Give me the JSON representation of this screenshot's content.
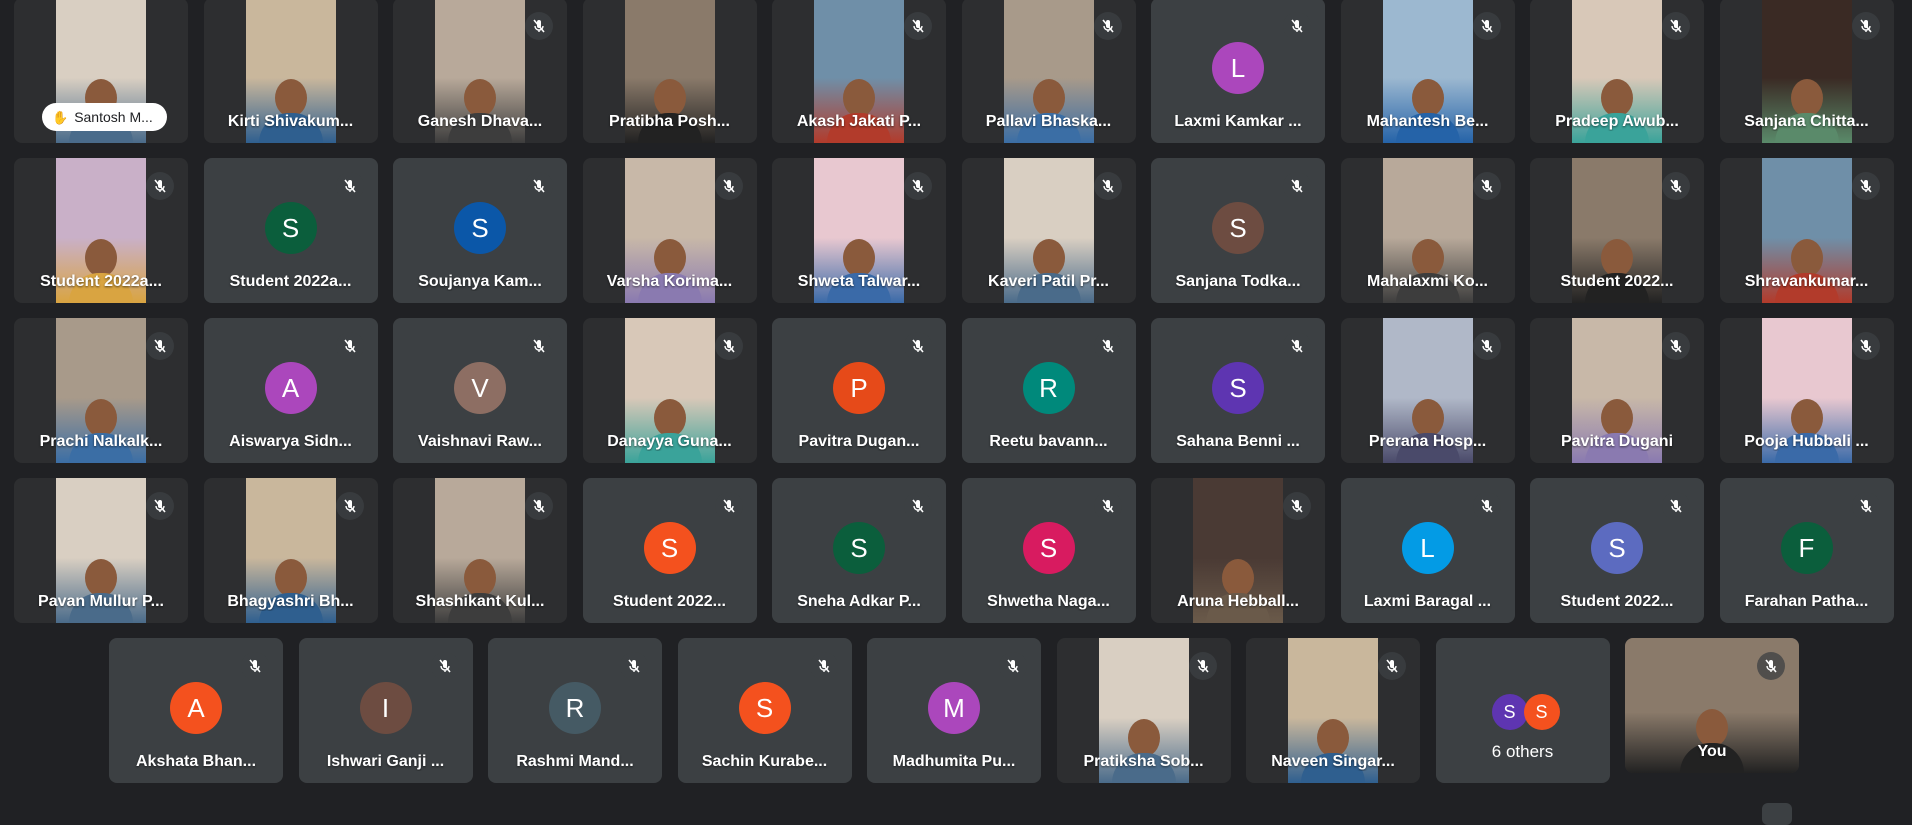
{
  "participants": [
    {
      "name": "Santosh M...",
      "type": "video",
      "muted": false,
      "raised_hand": true
    },
    {
      "name": "Kirti Shivakum...",
      "type": "video",
      "muted": false
    },
    {
      "name": "Ganesh Dhava...",
      "type": "video",
      "muted": true
    },
    {
      "name": "Pratibha Posh...",
      "type": "video",
      "muted": false
    },
    {
      "name": "Akash Jakati P...",
      "type": "video",
      "muted": true
    },
    {
      "name": "Pallavi Bhaska...",
      "type": "video",
      "muted": true
    },
    {
      "name": "Laxmi Kamkar ...",
      "type": "avatar",
      "initial": "L",
      "color": "#ab47bc",
      "muted": true
    },
    {
      "name": "Mahantesh Be...",
      "type": "video",
      "muted": true
    },
    {
      "name": "Pradeep Awub...",
      "type": "video",
      "muted": true
    },
    {
      "name": "Sanjana Chitta...",
      "type": "video",
      "muted": true
    },
    {
      "name": "Student 2022a...",
      "type": "video",
      "muted": true
    },
    {
      "name": "Student 2022a...",
      "type": "avatar",
      "initial": "S",
      "color": "#0b5e3c",
      "muted": true
    },
    {
      "name": "Soujanya Kam...",
      "type": "avatar",
      "initial": "S",
      "color": "#0b57a8",
      "muted": true
    },
    {
      "name": "Varsha Korima...",
      "type": "video",
      "muted": true
    },
    {
      "name": "Shweta Talwar...",
      "type": "video",
      "muted": true
    },
    {
      "name": "Kaveri Patil Pr...",
      "type": "video",
      "muted": true
    },
    {
      "name": "Sanjana Todka...",
      "type": "avatar",
      "initial": "S",
      "color": "#6d4c41",
      "muted": true
    },
    {
      "name": "Mahalaxmi Ko...",
      "type": "video",
      "muted": true
    },
    {
      "name": "Student 2022...",
      "type": "video",
      "muted": true
    },
    {
      "name": "Shravankumar...",
      "type": "video",
      "muted": true
    },
    {
      "name": "Prachi Nalkalk...",
      "type": "video",
      "muted": true
    },
    {
      "name": "Aiswarya Sidn...",
      "type": "avatar",
      "initial": "A",
      "color": "#ab47bc",
      "muted": true
    },
    {
      "name": "Vaishnavi Raw...",
      "type": "avatar",
      "initial": "V",
      "color": "#8d6e63",
      "muted": true
    },
    {
      "name": "Danayya Guna...",
      "type": "video",
      "muted": true
    },
    {
      "name": "Pavitra Dugan...",
      "type": "avatar",
      "initial": "P",
      "color": "#e64a19",
      "muted": true
    },
    {
      "name": "Reetu bavann...",
      "type": "avatar",
      "initial": "R",
      "color": "#00897b",
      "muted": true
    },
    {
      "name": "Sahana Benni ...",
      "type": "avatar",
      "initial": "S",
      "color": "#5e35b1",
      "muted": true
    },
    {
      "name": "Prerana Hosp...",
      "type": "video",
      "muted": true
    },
    {
      "name": "Pavitra Dugani",
      "type": "video",
      "muted": true
    },
    {
      "name": "Pooja Hubbali ...",
      "type": "video",
      "muted": true
    },
    {
      "name": "Pavan Mullur P...",
      "type": "video",
      "muted": true
    },
    {
      "name": "Bhagyashri Bh...",
      "type": "video",
      "muted": true
    },
    {
      "name": "Shashikant Kul...",
      "type": "video",
      "muted": true
    },
    {
      "name": "Student 2022...",
      "type": "avatar",
      "initial": "S",
      "color": "#f4511e",
      "muted": true
    },
    {
      "name": "Sneha Adkar P...",
      "type": "avatar",
      "initial": "S",
      "color": "#0b5e3c",
      "muted": true
    },
    {
      "name": "Shwetha Naga...",
      "type": "avatar",
      "initial": "S",
      "color": "#d81b60",
      "muted": true
    },
    {
      "name": "Aruna Hebball...",
      "type": "video",
      "muted": true
    },
    {
      "name": "Laxmi Baragal ...",
      "type": "avatar",
      "initial": "L",
      "color": "#039be5",
      "muted": true
    },
    {
      "name": "Student 2022...",
      "type": "avatar",
      "initial": "S",
      "color": "#5c6bc0",
      "muted": true
    },
    {
      "name": "Farahan Patha...",
      "type": "avatar",
      "initial": "F",
      "color": "#0b5e3c",
      "muted": true
    },
    {
      "name": "Akshata Bhan...",
      "type": "avatar",
      "initial": "A",
      "color": "#f4511e",
      "muted": true
    },
    {
      "name": "Ishwari Ganji ...",
      "type": "avatar",
      "initial": "I",
      "color": "#6d4c41",
      "muted": true
    },
    {
      "name": "Rashmi Mand...",
      "type": "avatar",
      "initial": "R",
      "color": "#455a64",
      "muted": true
    },
    {
      "name": "Sachin Kurabe...",
      "type": "avatar",
      "initial": "S",
      "color": "#f4511e",
      "muted": true
    },
    {
      "name": "Madhumita Pu...",
      "type": "avatar",
      "initial": "M",
      "color": "#ab47bc",
      "muted": true
    },
    {
      "name": "Pratiksha Sob...",
      "type": "video",
      "muted": true
    },
    {
      "name": "Naveen Singar...",
      "type": "video",
      "muted": true
    },
    {
      "type": "others",
      "label": "6 others",
      "initials": [
        "S",
        "S"
      ],
      "colors": [
        "#5e35b1",
        "#f4511e"
      ]
    },
    {
      "name": "You",
      "type": "video",
      "muted": true,
      "wide": true
    }
  ]
}
